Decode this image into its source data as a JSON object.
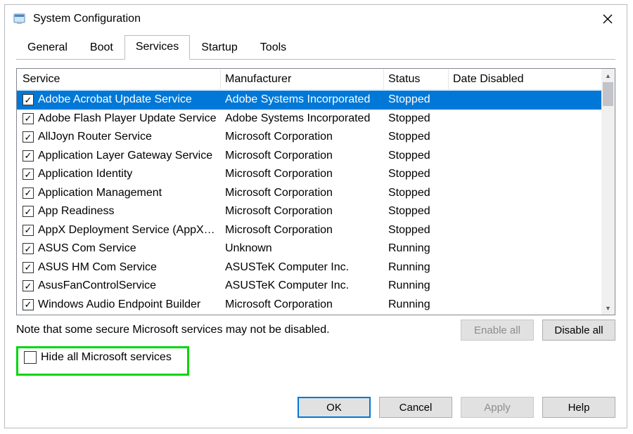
{
  "window": {
    "title": "System Configuration"
  },
  "tabs": {
    "general": "General",
    "boot": "Boot",
    "services": "Services",
    "startup": "Startup",
    "tools": "Tools"
  },
  "headers": {
    "service": "Service",
    "manufacturer": "Manufacturer",
    "status": "Status",
    "date_disabled": "Date Disabled"
  },
  "services": [
    {
      "checked": true,
      "name": "Adobe Acrobat Update Service",
      "manufacturer": "Adobe Systems Incorporated",
      "status": "Stopped",
      "date": ""
    },
    {
      "checked": true,
      "name": "Adobe Flash Player Update Service",
      "manufacturer": "Adobe Systems Incorporated",
      "status": "Stopped",
      "date": ""
    },
    {
      "checked": true,
      "name": "AllJoyn Router Service",
      "manufacturer": "Microsoft Corporation",
      "status": "Stopped",
      "date": ""
    },
    {
      "checked": true,
      "name": "Application Layer Gateway Service",
      "manufacturer": "Microsoft Corporation",
      "status": "Stopped",
      "date": ""
    },
    {
      "checked": true,
      "name": "Application Identity",
      "manufacturer": "Microsoft Corporation",
      "status": "Stopped",
      "date": ""
    },
    {
      "checked": true,
      "name": "Application Management",
      "manufacturer": "Microsoft Corporation",
      "status": "Stopped",
      "date": ""
    },
    {
      "checked": true,
      "name": "App Readiness",
      "manufacturer": "Microsoft Corporation",
      "status": "Stopped",
      "date": ""
    },
    {
      "checked": true,
      "name": "AppX Deployment Service (AppX…",
      "manufacturer": "Microsoft Corporation",
      "status": "Stopped",
      "date": ""
    },
    {
      "checked": true,
      "name": "ASUS Com Service",
      "manufacturer": "Unknown",
      "status": "Running",
      "date": ""
    },
    {
      "checked": true,
      "name": "ASUS HM Com Service",
      "manufacturer": "ASUSTeK Computer Inc.",
      "status": "Running",
      "date": ""
    },
    {
      "checked": true,
      "name": "AsusFanControlService",
      "manufacturer": "ASUSTeK Computer Inc.",
      "status": "Running",
      "date": ""
    },
    {
      "checked": true,
      "name": "Windows Audio Endpoint Builder",
      "manufacturer": "Microsoft Corporation",
      "status": "Running",
      "date": ""
    }
  ],
  "note": "Note that some secure Microsoft services may not be disabled.",
  "buttons": {
    "enable_all": "Enable all",
    "disable_all": "Disable all",
    "hide_label": "Hide all Microsoft services",
    "ok": "OK",
    "cancel": "Cancel",
    "apply": "Apply",
    "help": "Help"
  }
}
